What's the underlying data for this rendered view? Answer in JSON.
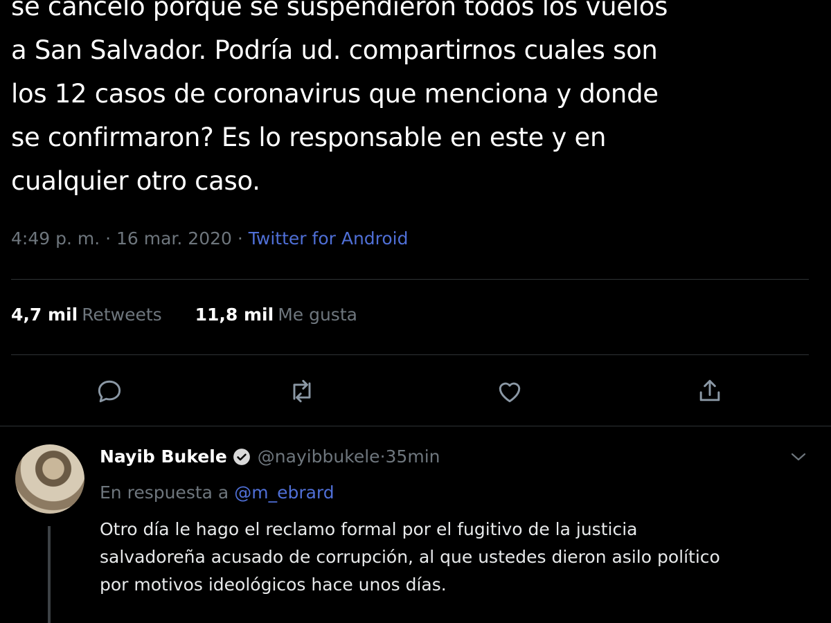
{
  "tweet": {
    "text_lines": [
      "se canceló porque se suspendieron todos los vuelos",
      "a San Salvador. Podría ud. compartirnos cuales son",
      "los 12 casos de coronavirus que menciona y donde",
      "se confirmaron? Es lo responsable en este y en",
      "cualquier otro caso."
    ],
    "time": "4:49 p. m.",
    "separator": " · ",
    "date": "16 mar. 2020",
    "source": "Twitter for Android",
    "retweets_count": "4,7 mil",
    "retweets_label": "Retweets",
    "likes_count": "11,8 mil",
    "likes_label": "Me gusta"
  },
  "actions": {
    "reply_icon": "reply-icon",
    "retweet_icon": "retweet-icon",
    "like_icon": "heart-icon",
    "share_icon": "share-icon"
  },
  "reply": {
    "name": "Nayib Bukele",
    "handle": "@nayibbukele",
    "time_sep": " · ",
    "time": "35min",
    "in_reply_prefix": "En respuesta a",
    "in_reply_mention": "@m_ebrard",
    "text_lines": [
      "Otro día le hago el reclamo formal por el fugitivo de la justicia",
      "salvadoreña acusado de corrupción, al que ustedes dieron asilo político",
      "por motivos ideológicos hace unos días."
    ]
  },
  "colors": {
    "background": "#000000",
    "text": "#ffffff",
    "muted": "#6e767d",
    "link": "#4f6fd6",
    "divider": "#2f3336"
  }
}
